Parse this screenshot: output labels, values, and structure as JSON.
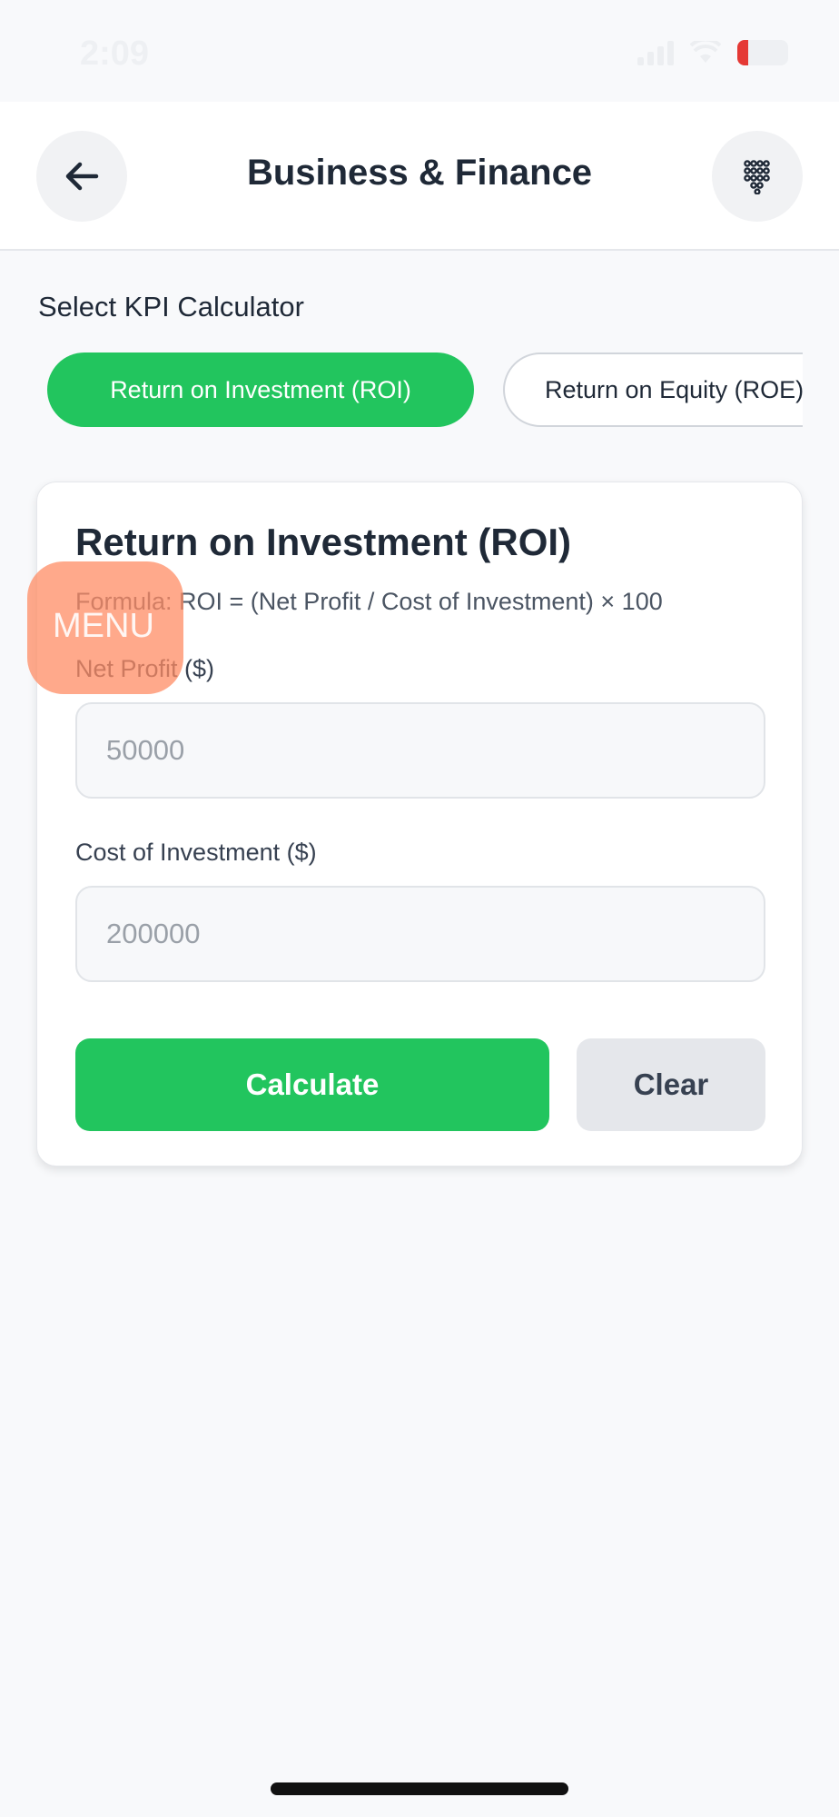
{
  "status_bar": {
    "time": "2:09"
  },
  "header": {
    "title": "Business & Finance"
  },
  "selector": {
    "label": "Select KPI Calculator",
    "chips": [
      {
        "label": "Return on Investment (ROI)",
        "active": true
      },
      {
        "label": "Return on Equity (ROE)",
        "active": false
      }
    ]
  },
  "card": {
    "title": "Return on Investment (ROI)",
    "formula": "Formula: ROI = (Net Profit / Cost of Investment) × 100",
    "fields": [
      {
        "label": "Net Profit ($)",
        "placeholder": "50000"
      },
      {
        "label": "Cost of Investment ($)",
        "placeholder": "200000"
      }
    ],
    "calculate_label": "Calculate",
    "clear_label": "Clear"
  },
  "overlay": {
    "menu_label": "MENU"
  },
  "colors": {
    "accent": "#22c55e",
    "secondary_button": "#e5e7eb",
    "overlay": "#ff8c64"
  }
}
